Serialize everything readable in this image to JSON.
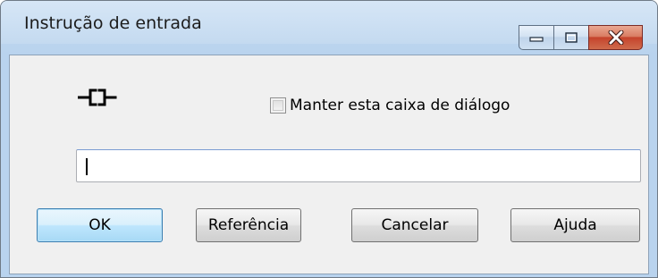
{
  "window": {
    "title": "Instrução de entrada",
    "controls": {
      "minimize_icon": "minimize-icon",
      "maximize_icon": "maximize-icon",
      "close_icon": "close-icon"
    }
  },
  "dialog": {
    "instruction_icon": "contact-instruction-icon",
    "keep_dialog_label": "Manter esta caixa de diálogo",
    "keep_dialog_checked": false,
    "input_value": "",
    "input_placeholder": ""
  },
  "buttons": {
    "ok": "OK",
    "reference": "Referência",
    "cancel": "Cancelar",
    "help": "Ajuda"
  },
  "colors": {
    "title_bar": "#c4daf0",
    "close_button": "#c5442c",
    "default_button": "#3c7fb1"
  }
}
